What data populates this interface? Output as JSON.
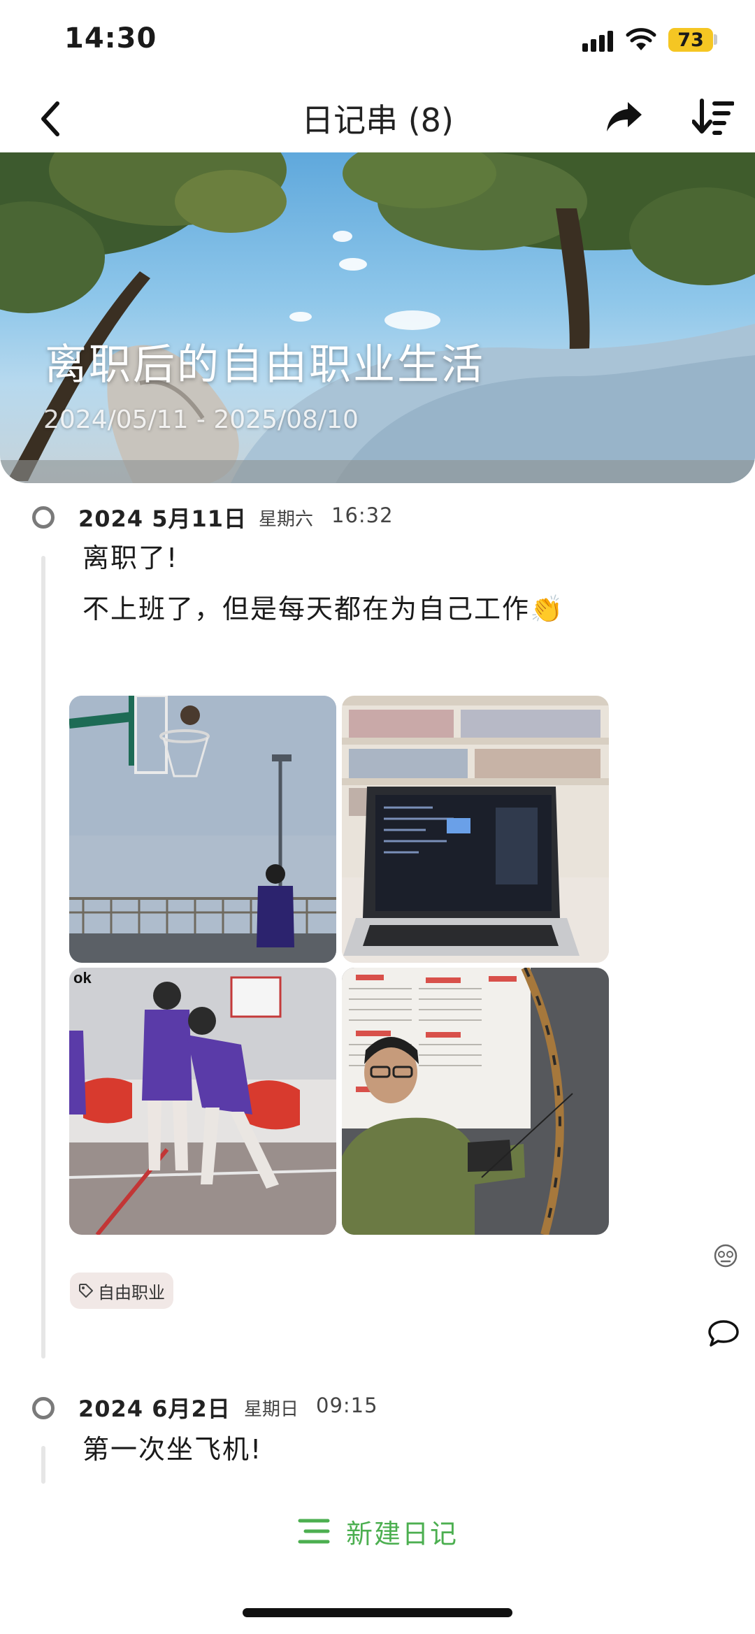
{
  "status_bar": {
    "time": "14:30",
    "battery": "73"
  },
  "nav": {
    "title": "日记串 (8)"
  },
  "cover": {
    "title": "离职后的自由职业生活",
    "date_range": "2024/05/11 - 2025/08/10"
  },
  "entries": [
    {
      "date": "2024  5月11日",
      "weekday": "星期六",
      "time": "16:32",
      "lines": [
        "离职了!",
        "不上班了，但是每天都在为自己工作👏"
      ],
      "photos": [
        "basketball-shot-photo",
        "laptop-library-photo",
        "basketball-team-photo",
        "archery-photo"
      ],
      "tag": "自由职业"
    },
    {
      "date": "2024  6月2日",
      "weekday": "星期日",
      "time": "09:15",
      "lines": [
        "第一次坐飞机!"
      ]
    }
  ],
  "actions": {
    "new_entry": "新建日记"
  },
  "icons": {
    "back": "chevron-left-icon",
    "share": "share-arrow-icon",
    "sort": "sort-descending-icon",
    "emoji": "face-icon",
    "comment": "chat-bubble-icon",
    "tag": "tag-icon",
    "new": "menu-lines-icon"
  },
  "colors": {
    "accent": "#4caf50",
    "battery": "#f5c623",
    "tag_bg": "#f1e8e6"
  }
}
